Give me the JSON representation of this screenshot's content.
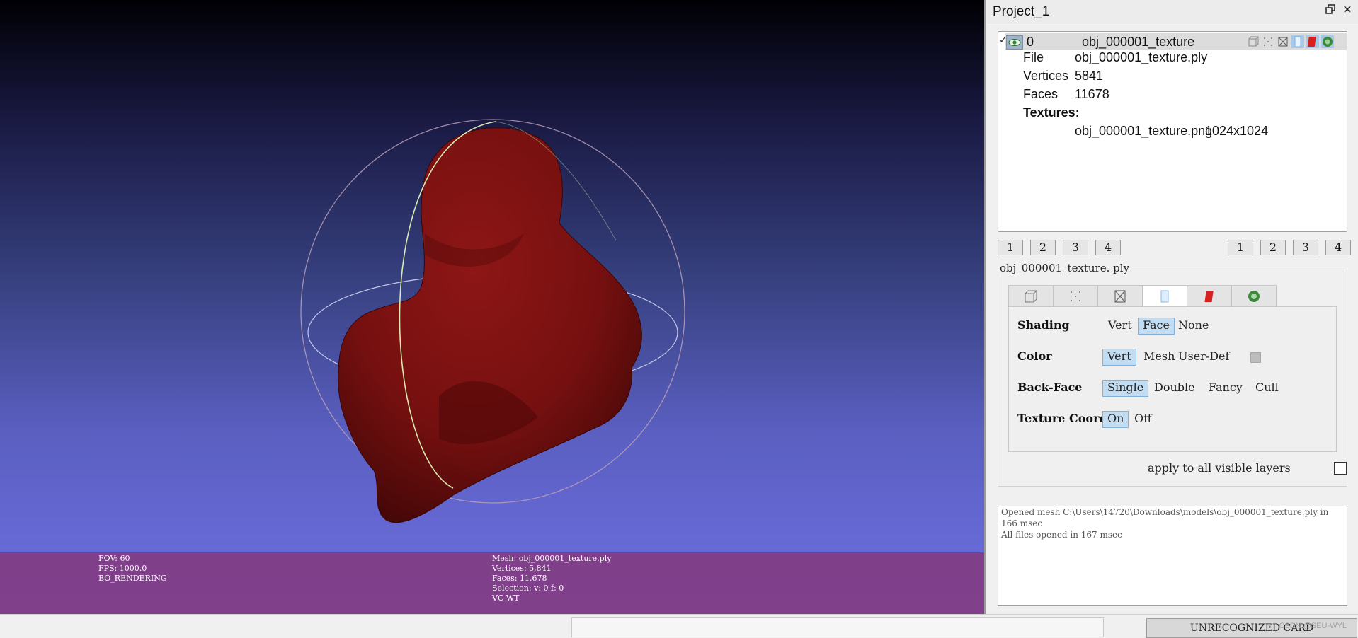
{
  "viewport": {
    "info_left": [
      "FOV: 60",
      "FPS:  1000.0",
      "BO_RENDERING"
    ],
    "info_mid": [
      "Mesh: obj_000001_texture.ply",
      "Vertices: 5,841",
      "Faces: 11,678",
      "Selection: v: 0 f: 0",
      "VC WT"
    ],
    "colors": {
      "mesh": "#7a1212",
      "mesh_dark": "#4a0808",
      "info_bar": "#823c82"
    }
  },
  "panel": {
    "title": "Project_1",
    "icons": {
      "float": "float-window-icon",
      "close": "close-icon"
    },
    "layer": {
      "index": "0",
      "name": "obj_000001_texture",
      "file_label": "File",
      "file_value": "obj_000001_texture.ply",
      "vertices_label": "Vertices",
      "vertices_value": "5841",
      "faces_label": "Faces",
      "faces_value": "11678",
      "textures_label": "Textures:",
      "texture_file": "obj_000001_texture.png",
      "texture_size": "1024x1024"
    },
    "view_buttons_left": [
      "1",
      "2",
      "3",
      "4"
    ],
    "view_buttons_right": [
      "1",
      "2",
      "3",
      "4"
    ],
    "params_title": "obj_000001_texture. ply",
    "render": {
      "shading_label": "Shading",
      "shading_options": [
        "Vert",
        "Face",
        "None"
      ],
      "color_label": "Color",
      "color_options": [
        "Vert",
        "Mesh",
        "User-Def"
      ],
      "backface_label": "Back-Face",
      "backface_options": [
        "Single",
        "Double",
        "Fancy",
        "Cull"
      ],
      "texcoord_label": "Texture Coord",
      "texcoord_options": [
        "On",
        "Off"
      ]
    },
    "apply_label": "apply to all visible layers",
    "log": [
      "Opened mesh C:\\Users\\14720\\Downloads\\models\\obj_000001_texture.ply in 166 msec",
      "All files opened in 167 msec"
    ]
  },
  "status": {
    "card": "UNRECOGNIZED CARD",
    "watermark": "CSDN @SEU-WYL"
  }
}
